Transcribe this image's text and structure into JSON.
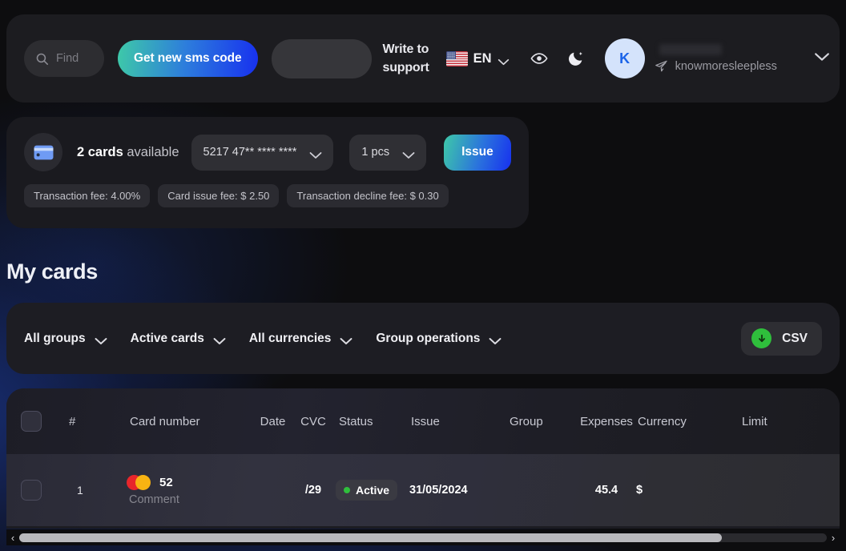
{
  "header": {
    "search_placeholder": "Find",
    "search_value": "",
    "sms_button": "Get new sms code",
    "code_input_value": "",
    "code_input_placeholder": "",
    "support_link": "Write to support",
    "language": "EN",
    "avatar_initial": "K",
    "user_handle": "knowmoresleepless"
  },
  "issue_panel": {
    "available_count": "2 cards",
    "available_suffix": " available",
    "bin_selected": "5217 47** **** ****",
    "qty_selected": "1 pcs",
    "issue_button": "Issue",
    "fees": [
      "Transaction fee: 4.00%",
      "Card issue fee: $ 2.50",
      "Transaction decline fee: $ 0.30"
    ]
  },
  "page_title": "My cards",
  "filters": {
    "groups": "All groups",
    "cards": "Active cards",
    "currencies": "All currencies",
    "operations": "Group operations",
    "csv_button": "CSV"
  },
  "table": {
    "columns": {
      "num": "#",
      "card_number": "Card number",
      "date": "Date",
      "cvc": "CVC",
      "status": "Status",
      "issue": "Issue",
      "group": "Group",
      "expenses": "Expenses",
      "currency": "Currency",
      "limit": "Limit"
    },
    "rows": [
      {
        "num": "1",
        "card_number": "52",
        "comment": "Comment",
        "date": "",
        "cvc": "/29",
        "status": "Active",
        "issue": "31/05/2024",
        "group": "",
        "expenses": "45.4",
        "currency": "$",
        "limit": ""
      }
    ]
  },
  "scrollbar": {
    "left_arrow": "‹",
    "right_arrow": "›"
  },
  "colors": {
    "accent_green": "#2fbf3c",
    "gradient_start": "#3ec9a8",
    "gradient_end": "#1730ef",
    "avatar_bg": "#d4e3fb",
    "avatar_text": "#1a63e8"
  }
}
